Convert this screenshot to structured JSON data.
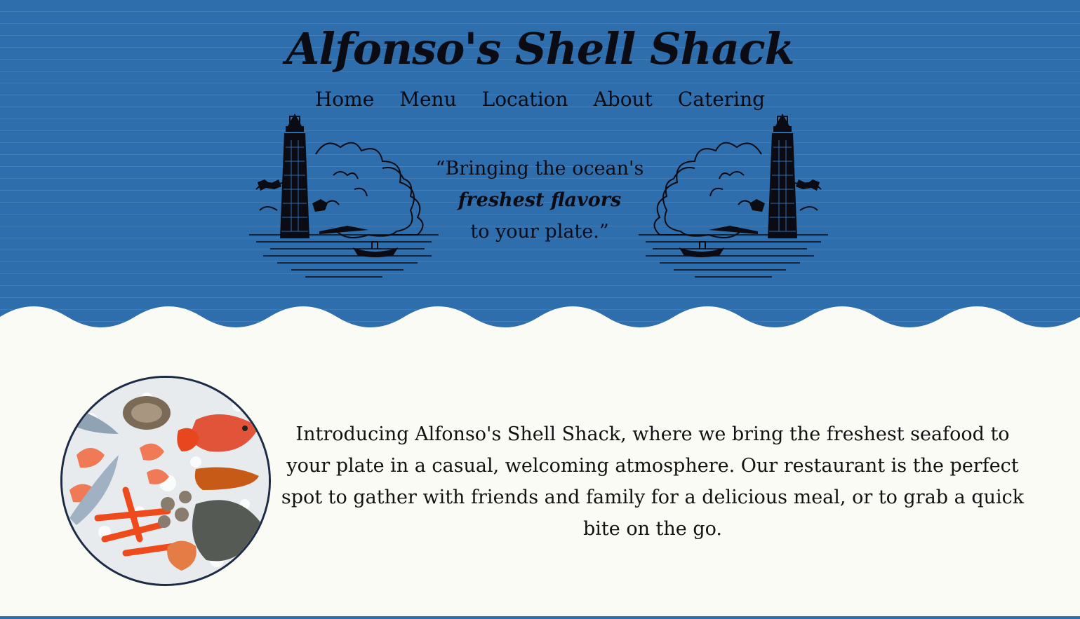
{
  "header": {
    "title": "Alfonso's Shell Shack",
    "nav": [
      {
        "label": "Home"
      },
      {
        "label": "Menu"
      },
      {
        "label": "Location"
      },
      {
        "label": "About"
      },
      {
        "label": "Catering"
      }
    ],
    "tagline": {
      "line1": "“Bringing the ocean's",
      "line2": "freshest flavors",
      "line3": "to your plate.”"
    }
  },
  "intro": {
    "text": "Introducing Alfonso's Shell Shack, where we bring the freshest seafood to your plate in a casual, welcoming atmosphere. Our restaurant is the perfect spot to gather with friends and family for a delicious meal, or to grab a quick bite on the go."
  },
  "colors": {
    "header_blue": "#2e6ead",
    "page_cream": "#fbfbf6",
    "ink": "#0b0b14"
  },
  "icons": {
    "left_illustration": "lighthouse-icon",
    "right_illustration": "lighthouse-icon",
    "photo": "seafood-platter-image"
  }
}
